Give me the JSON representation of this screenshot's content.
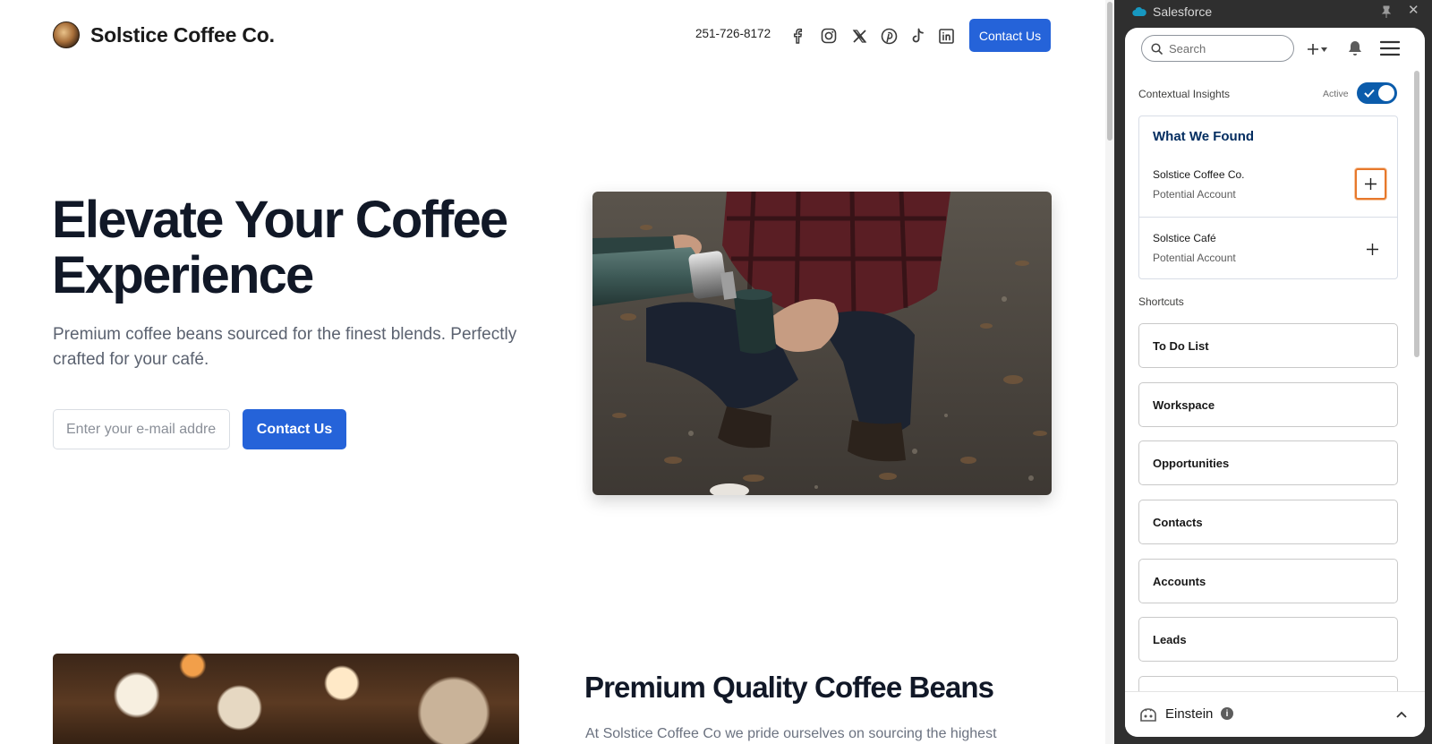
{
  "website": {
    "brand": "Solstice Coffee Co.",
    "nav": {
      "phone": "251-726-8172",
      "social_icons": [
        "facebook-icon",
        "instagram-icon",
        "x-icon",
        "pinterest-icon",
        "tiktok-icon",
        "linkedin-icon"
      ],
      "contact_label": "Contact Us"
    },
    "hero": {
      "title": "Elevate Your Coffee Experience",
      "subtitle": "Premium coffee beans sourced for the finest blends. Perfectly crafted for your café.",
      "email_placeholder": "Enter your e-mail address",
      "cta_label": "Contact Us"
    },
    "section": {
      "title": "Premium Quality Coffee Beans",
      "body": "At Solstice Coffee Co we pride ourselves on sourcing the highest"
    },
    "accent_color": "#2563d9"
  },
  "salesforce": {
    "app_title": "Salesforce",
    "search_placeholder": "Search",
    "insights": {
      "label": "Contextual Insights",
      "status": "Active",
      "enabled": true
    },
    "found": {
      "title": "What We Found",
      "items": [
        {
          "name": "Solstice Coffee Co.",
          "type": "Potential Account"
        },
        {
          "name": "Solstice Café",
          "type": "Potential Account"
        }
      ]
    },
    "shortcuts": {
      "label": "Shortcuts",
      "items": [
        {
          "label": "To Do List"
        },
        {
          "label": "Workspace"
        },
        {
          "label": "Opportunities"
        },
        {
          "label": "Contacts"
        },
        {
          "label": "Accounts"
        },
        {
          "label": "Leads"
        }
      ]
    },
    "einstein": {
      "label": "Einstein",
      "info": "i"
    },
    "focus_color": "#e7782c",
    "brand_color": "#0b5cab"
  }
}
